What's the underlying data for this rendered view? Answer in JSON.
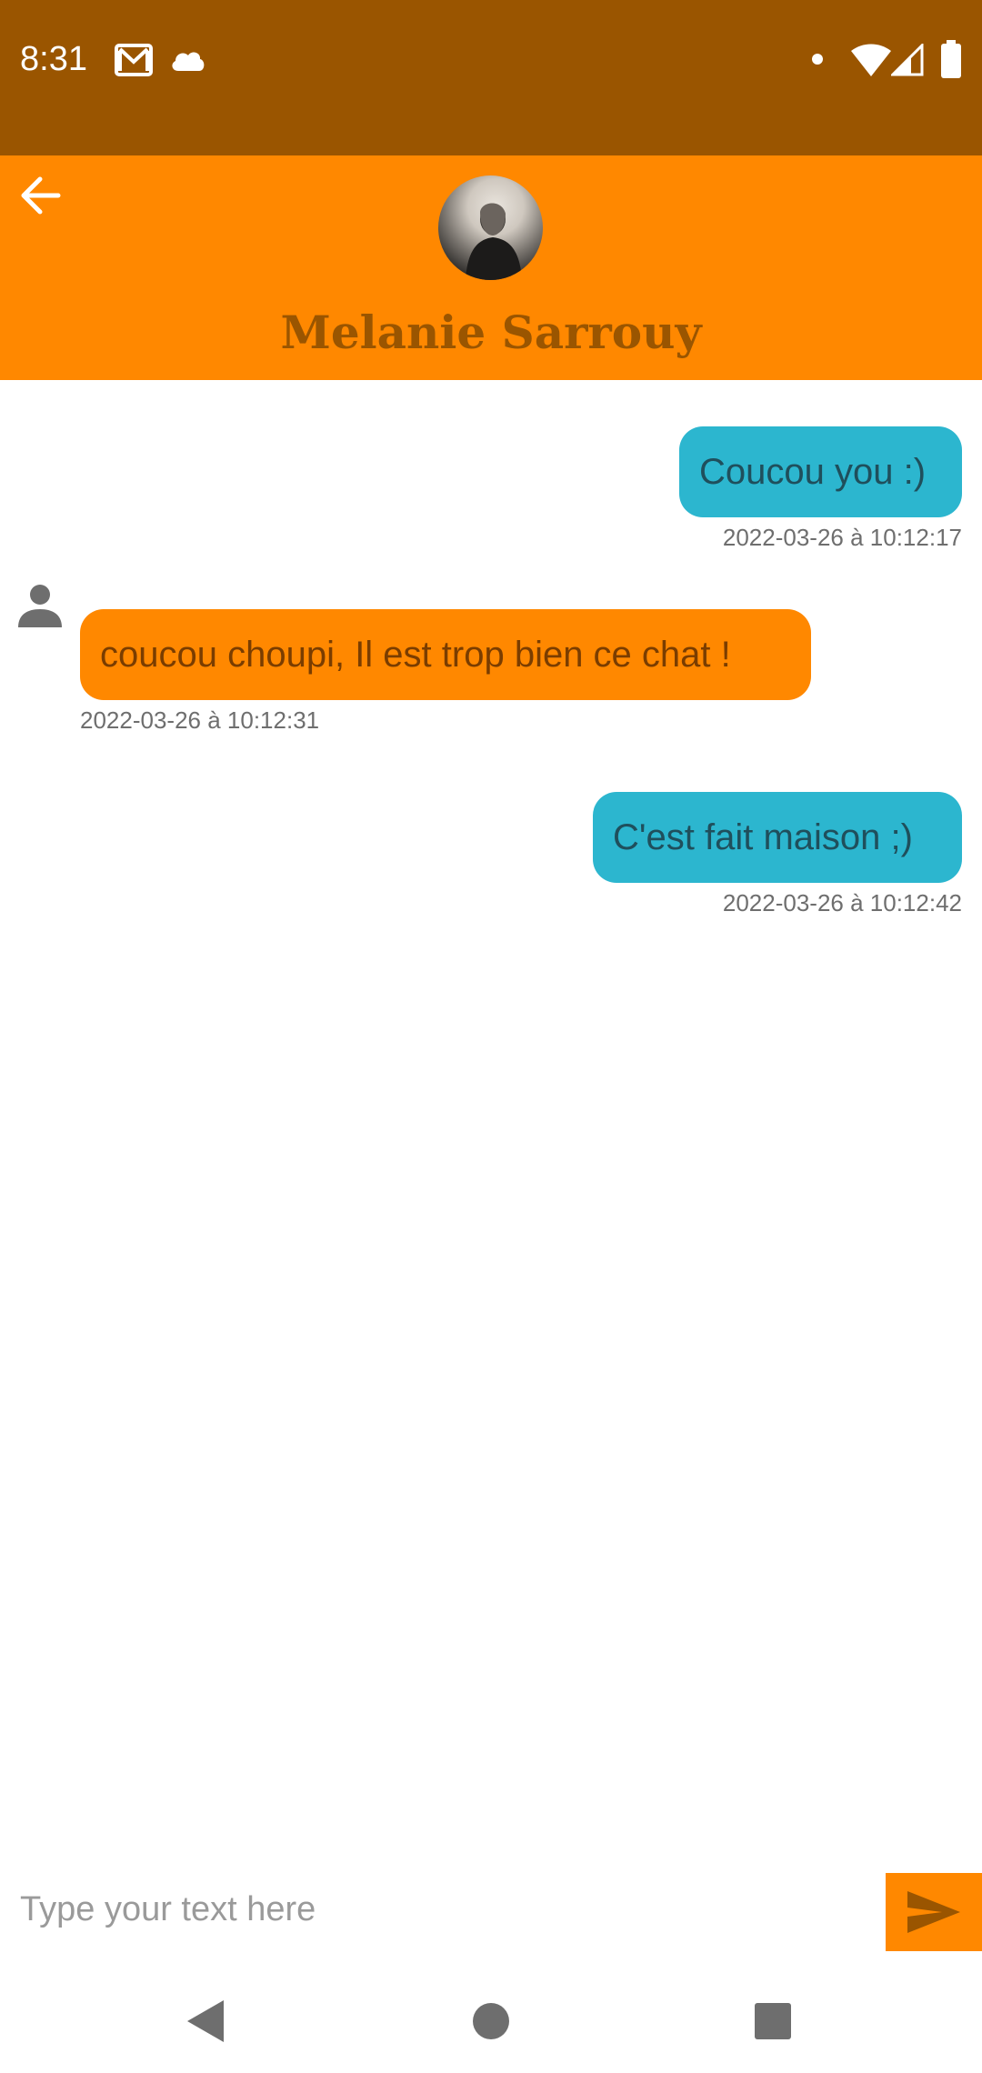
{
  "status_bar": {
    "time": "8:31",
    "icons": [
      "gmail-icon",
      "cloud-icon",
      "dot-icon",
      "wifi-icon",
      "signal-icon",
      "battery-icon"
    ],
    "background": "#9A5500"
  },
  "header": {
    "contact_name": "Melanie Sarrouy",
    "back_icon": "arrow-left-icon",
    "background": "#FF8800",
    "name_color": "#9A5500"
  },
  "messages": [
    {
      "direction": "outgoing",
      "text": "Coucou you :)",
      "timestamp": "2022-03-26 à 10:12:17",
      "color": "#2CB6CF"
    },
    {
      "direction": "incoming",
      "text": "coucou choupi, Il est trop bien ce chat !",
      "timestamp": "2022-03-26 à 10:12:31",
      "color": "#FF8800"
    },
    {
      "direction": "outgoing",
      "text": "C'est fait maison ;)",
      "timestamp": "2022-03-26 à 10:12:42",
      "color": "#2CB6CF"
    }
  ],
  "composer": {
    "placeholder": "Type your text here",
    "value": "",
    "send_icon": "send-icon"
  },
  "nav": {
    "icons": [
      "back-triangle-icon",
      "home-circle-icon",
      "recents-square-icon"
    ]
  }
}
